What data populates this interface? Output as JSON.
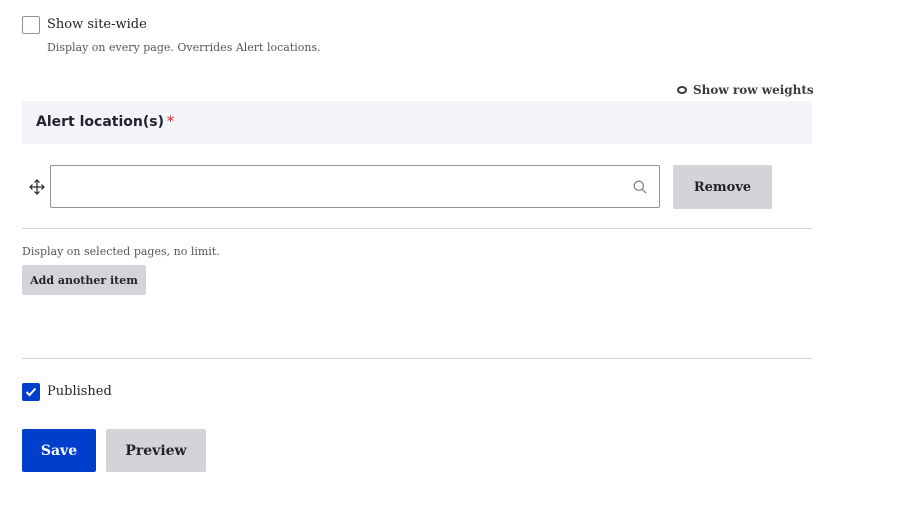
{
  "site_wide": {
    "label": "Show site-wide",
    "description": "Display on every page. Overrides Alert locations.",
    "checked": false
  },
  "row_weights": {
    "label": "Show row weights"
  },
  "alert_locations": {
    "title": "Alert location(s)",
    "required_marker": "*",
    "input_value": "",
    "remove_label": "Remove",
    "description": "Display on selected pages, no limit.",
    "add_label": "Add another item"
  },
  "published": {
    "label": "Published",
    "checked": true
  },
  "actions": {
    "save_label": "Save",
    "preview_label": "Preview"
  },
  "colors": {
    "primary": "#003ecc",
    "required": "#dc2323",
    "header_bg": "#f3f4f9"
  }
}
